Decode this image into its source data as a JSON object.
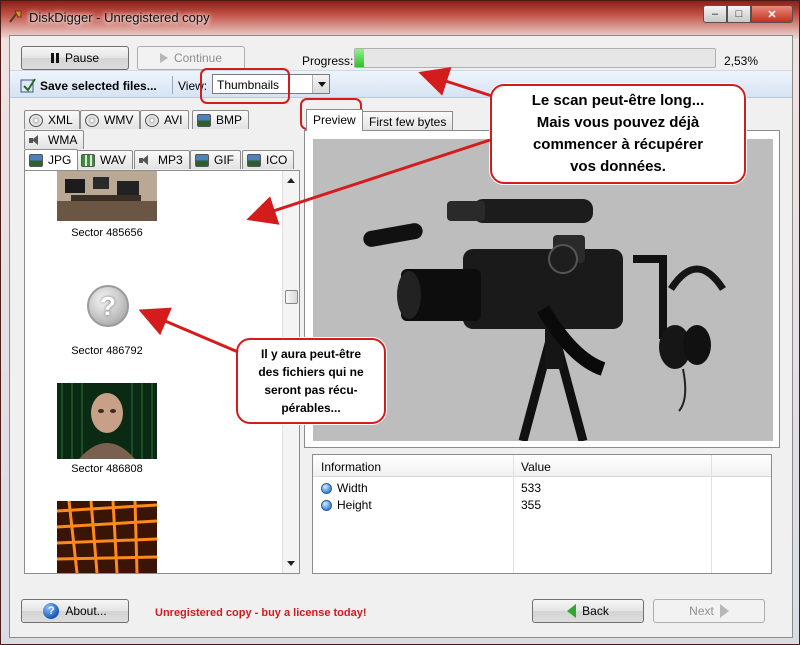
{
  "window": {
    "title": "DiskDigger - Unregistered copy",
    "buttons": {
      "minimize": "–",
      "maximize": "□",
      "close": "✕"
    }
  },
  "controls": {
    "pause_label": "Pause",
    "continue_label": "Continue",
    "progress_label": "Progress:",
    "progress_value": "2,53%",
    "progress_fraction": 0.0253
  },
  "toolbar": {
    "save_label": "Save selected files...",
    "view_label": "View:",
    "view_selected": "Thumbnails"
  },
  "file_tabs": {
    "row1": [
      "XML",
      "WMV",
      "AVI",
      "BMP"
    ],
    "row2": [
      "WMA"
    ],
    "row3": [
      "JPG",
      "WAV",
      "MP3",
      "GIF",
      "ICO"
    ],
    "active": "JPG"
  },
  "file_list": [
    {
      "label": "Sector 485656",
      "thumb": "studio-photo"
    },
    {
      "label": "Sector 486792",
      "thumb": "question-mark"
    },
    {
      "label": "Sector 486808",
      "thumb": "bald-head-render"
    },
    {
      "label": "",
      "thumb": "orange-grid"
    }
  ],
  "preview_tabs": {
    "preview": "Preview",
    "bytes": "First few bytes"
  },
  "info_table": {
    "headers": [
      "Information",
      "Value"
    ],
    "rows": [
      {
        "name": "Width",
        "value": "533"
      },
      {
        "name": "Height",
        "value": "355"
      }
    ]
  },
  "footer": {
    "about_label": "About...",
    "unregistered_text": "Unregistered copy - buy a license today!",
    "back_label": "Back",
    "next_label": "Next"
  },
  "annotations": {
    "scan_note": [
      "Le scan peut-être long...",
      "Mais vous pouvez déjà",
      "commencer à récupérer",
      "vos données."
    ],
    "unrecoverable_note": [
      "Il y aura peut-être",
      "des fichiers qui ne",
      "seront pas récu-",
      "pérables..."
    ]
  },
  "colors": {
    "annotation_red": "#d51c1c",
    "progress_green": "#2fbf2a",
    "unregistered_red": "#d11b1b",
    "toolbar_blue": "#d6e3f3"
  }
}
